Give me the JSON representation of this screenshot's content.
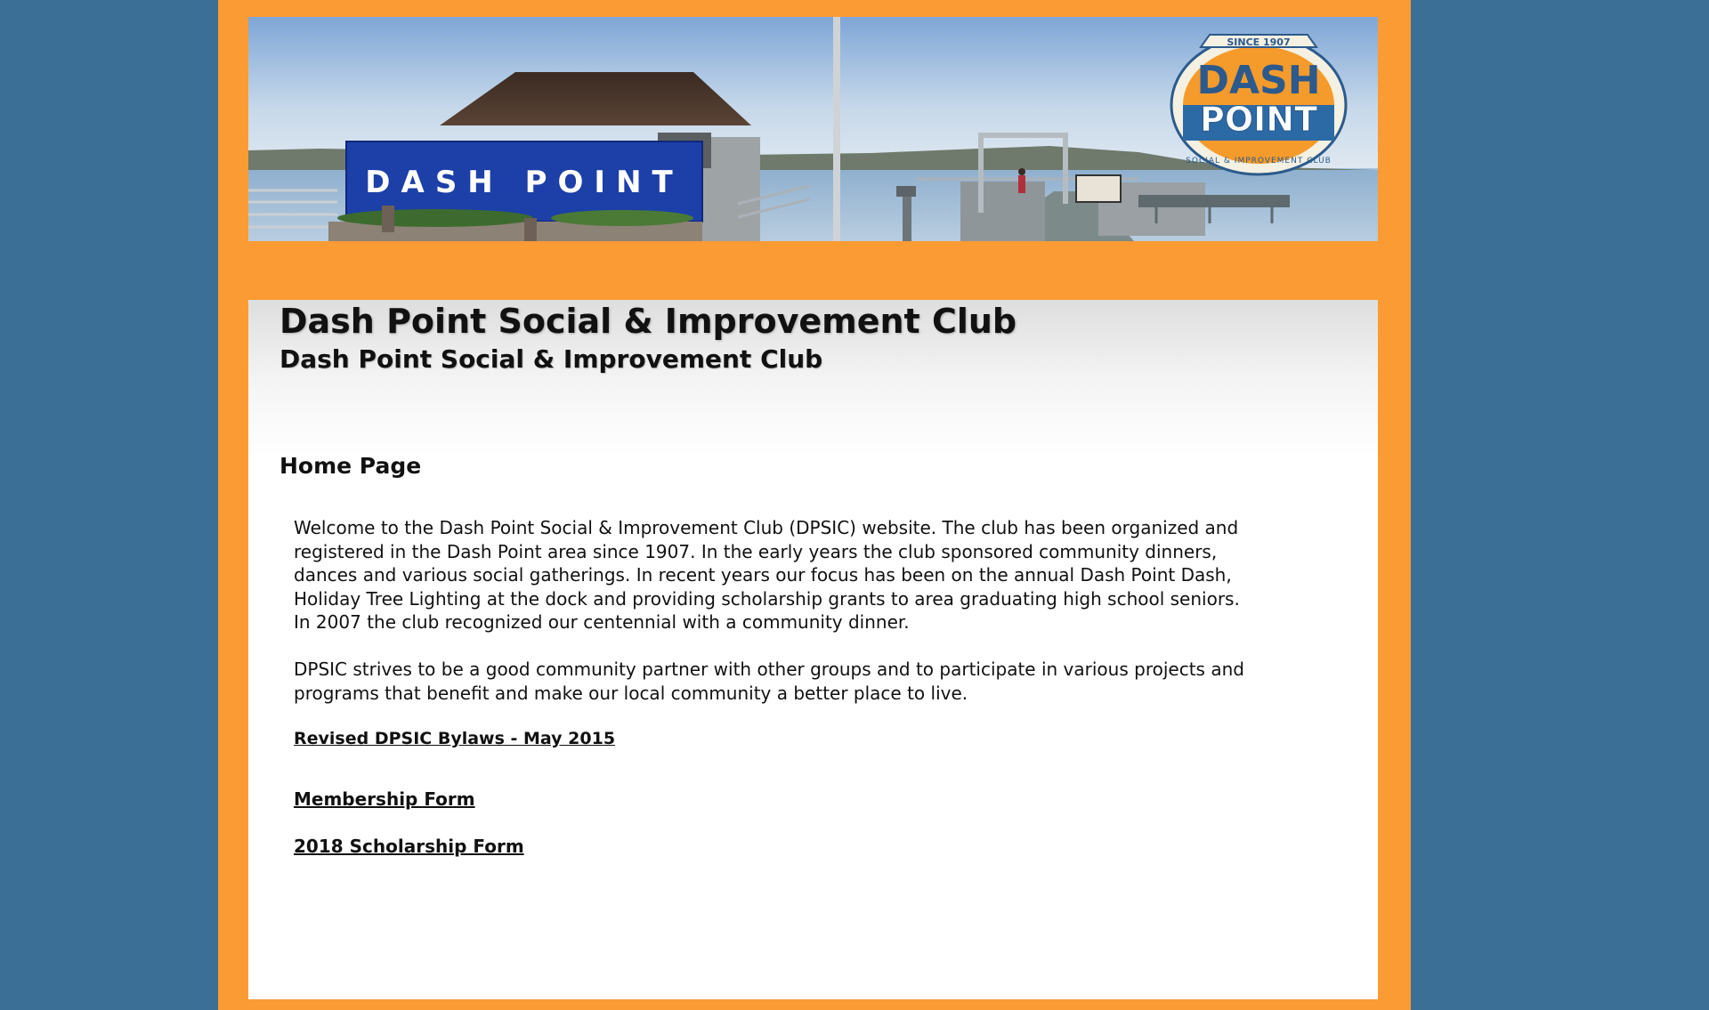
{
  "site": {
    "title": "Dash Point Social & Improvement Club",
    "subtitle": "Dash Point Social & Improvement Club"
  },
  "banner": {
    "sign_text": "DASH POINT",
    "logo": {
      "since": "SINCE 1907",
      "word1": "DASH",
      "word2": "POINT",
      "ring_text": "SOCIAL & IMPROVEMENT CLUB"
    }
  },
  "page": {
    "heading": "Home Page",
    "paragraphs": [
      "Welcome to the Dash Point Social & Improvement Club (DPSIC) website.  The club has been organized and registered in the Dash Point area since 1907.  In the early years the club sponsored community dinners, dances and various social gatherings.  In recent years our focus has been on the annual Dash Point Dash, Holiday Tree Lighting at the dock and providing scholarship grants to area graduating high school seniors.  In 2007 the club recognized our centennial with a community dinner.",
      "DPSIC strives to be a good community partner with other groups and to participate in various projects and programs that benefit and make our local community a better place to live."
    ],
    "links": {
      "bylaws": "Revised DPSIC Bylaws - May 2015",
      "membership": "Membership Form",
      "scholarship": "2018 Scholarship Form"
    }
  },
  "colors": {
    "background": "#3c6f96",
    "frame": "#fb9b33",
    "sign_blue": "#1c3fa8"
  }
}
